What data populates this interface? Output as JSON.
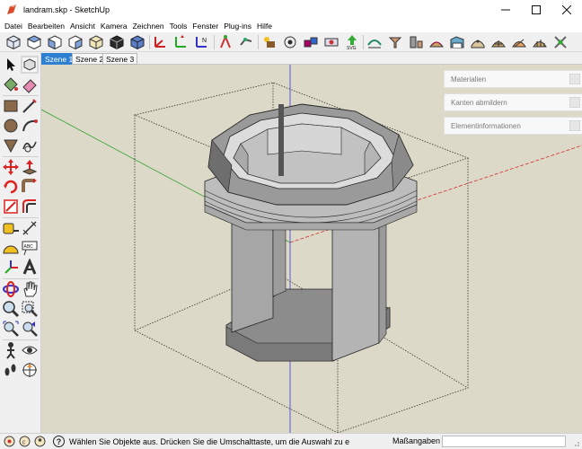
{
  "window": {
    "title": "landram.skp - SketchUp"
  },
  "menu": [
    "Datei",
    "Bearbeiten",
    "Ansicht",
    "Kamera",
    "Zeichnen",
    "Tools",
    "Fenster",
    "Plug-ins",
    "Hilfe"
  ],
  "scenes": [
    {
      "label": "Szene 1",
      "active": true
    },
    {
      "label": "Szene 2",
      "active": false
    },
    {
      "label": "Szene 3",
      "active": false
    }
  ],
  "tray": {
    "panels": [
      "Materialien",
      "Kanten abmildern",
      "Elementinformationen"
    ]
  },
  "status": {
    "hint": "Wählen Sie Objekte aus. Drücken Sie die Umschalttaste, um die Auswahl zu e",
    "measurements_label": "Maßangaben",
    "measurements_value": ""
  },
  "colors": {
    "background": "#ddd9c8",
    "active_tab": "#2c7fd1",
    "axis_red": "#d33030",
    "axis_green": "#2ea02e",
    "axis_blue": "#3a3ad0"
  }
}
